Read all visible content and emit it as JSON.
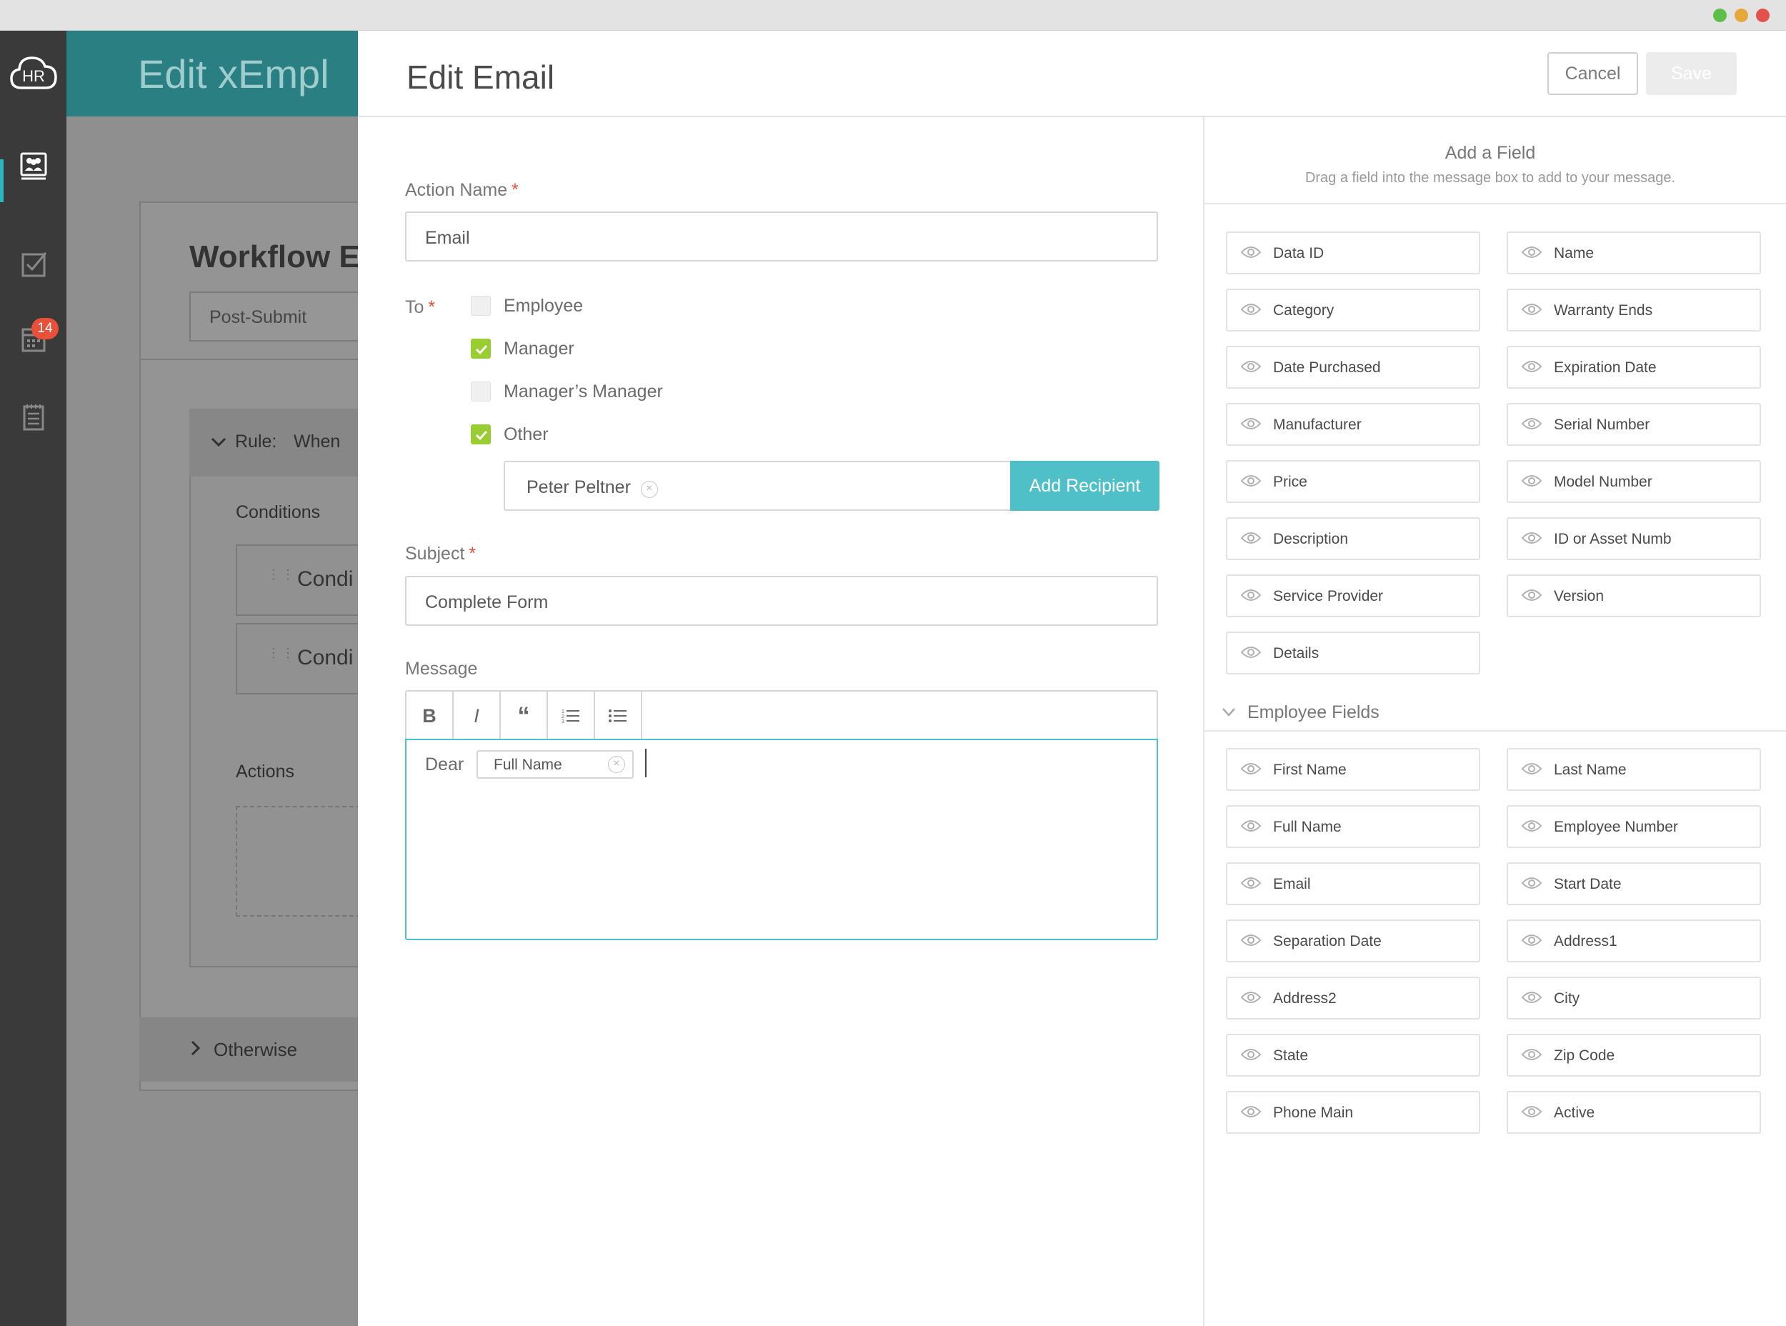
{
  "nav": {
    "logo_text": "HR",
    "badge_count": "14",
    "icons": [
      "people-icon",
      "checkbox-icon",
      "calendar-icon",
      "notes-icon"
    ]
  },
  "background": {
    "header_title": "Edit xEmpl",
    "card_title": "Workflow E",
    "trigger_select": "Post-Submit",
    "rule_label": "Rule:",
    "rule_when": "When",
    "conditions_label": "Conditions",
    "condition_1": "Condi",
    "condition_2": "Condi",
    "actions_label": "Actions",
    "otherwise_label": "Otherwise"
  },
  "modal": {
    "title": "Edit Email",
    "cancel_label": "Cancel",
    "save_label": "Save"
  },
  "form": {
    "action_name_label": "Action Name",
    "action_name_value": "Email",
    "to_label": "To",
    "recipients": [
      {
        "label": "Employee",
        "checked": false
      },
      {
        "label": "Manager",
        "checked": true
      },
      {
        "label": "Manager’s Manager",
        "checked": false
      },
      {
        "label": "Other",
        "checked": true
      }
    ],
    "other_recipient": "Peter Peltner",
    "add_recipient_label": "Add Recipient",
    "subject_label": "Subject",
    "subject_value": "Complete Form",
    "message_label": "Message",
    "toolbar": {
      "bold": "B",
      "italic": "I",
      "quote": "“",
      "ordered_list": "ordered-list-icon",
      "bullet_list": "bullet-list-icon"
    },
    "message_text": "Dear",
    "message_field_chip": "Full Name",
    "required_mark": "*"
  },
  "fields_panel": {
    "title": "Add a Field",
    "subtitle": "Drag a field into the message box to add to your message.",
    "asset_fields": [
      "Data ID",
      "Name",
      "Category",
      "Warranty Ends",
      "Date Purchased",
      "Expiration Date",
      "Manufacturer",
      "Serial Number",
      "Price",
      "Model Number",
      "Description",
      "ID or Asset Numb",
      "Service Provider",
      "Version",
      "Details"
    ],
    "employee_section_title": "Employee Fields",
    "employee_fields": [
      "First Name",
      "Last Name",
      "Full Name",
      "Employee Number",
      "Email",
      "Start Date",
      "Separation Date",
      "Address1",
      "Address2",
      "City",
      "State",
      "Zip Code",
      "Phone Main",
      "Active"
    ]
  },
  "colors": {
    "accent": "#4fc0c8",
    "check": "#9acd32",
    "badge": "#e8503a",
    "nav_bg": "#3a3a3a",
    "header_teal": "#2a7f83"
  }
}
